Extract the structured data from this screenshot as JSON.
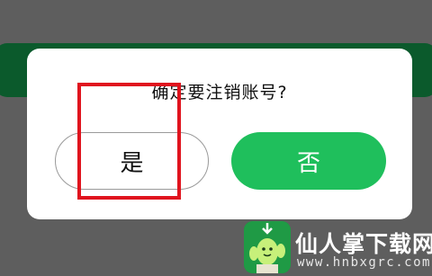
{
  "dialog": {
    "question": "确定要注销账号?",
    "yes_label": "是",
    "no_label": "否"
  },
  "colors": {
    "backdrop": "#5e5e5e",
    "background_bar": "#0b5a2c",
    "no_button": "#1fbf5c",
    "highlight": "#e0141e"
  },
  "watermark": {
    "title": "仙人掌下载网",
    "url": "www.hnbxgrc.com",
    "logo_icon": "cactus-icon"
  }
}
